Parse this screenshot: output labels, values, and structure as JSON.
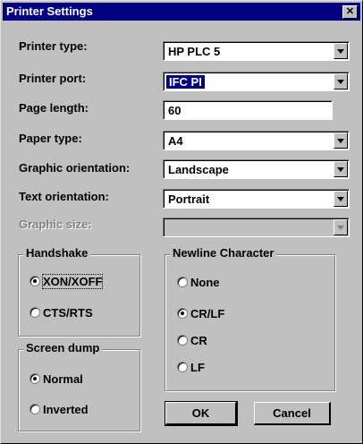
{
  "window": {
    "title": "Printer Settings",
    "close": "✕"
  },
  "fields": [
    {
      "label": "Printer type:",
      "value": "HP PLC 5"
    },
    {
      "label": "Printer port:",
      "value": "IFC PI"
    },
    {
      "label": "Page length:",
      "value": "60"
    },
    {
      "label": "Paper type:",
      "value": "A4"
    },
    {
      "label": "Graphic orientation:",
      "value": "Landscape"
    },
    {
      "label": "Text orientation:",
      "value": "Portrait"
    },
    {
      "label": "Graphic size:",
      "value": ""
    }
  ],
  "handshake": {
    "title": "Handshake",
    "options": [
      {
        "label": "XON/XOFF",
        "selected": true
      },
      {
        "label": "CTS/RTS",
        "selected": false
      }
    ]
  },
  "screen_dump": {
    "title": "Screen dump",
    "options": [
      {
        "label": "Normal",
        "selected": true
      },
      {
        "label": "Inverted",
        "selected": false
      }
    ]
  },
  "newline": {
    "title": "Newline Character",
    "options": [
      {
        "label": "None",
        "selected": false
      },
      {
        "label": "CR/LF",
        "selected": true
      },
      {
        "label": "CR",
        "selected": false
      },
      {
        "label": "LF",
        "selected": false
      }
    ]
  },
  "buttons": {
    "ok": "OK",
    "cancel": "Cancel"
  }
}
